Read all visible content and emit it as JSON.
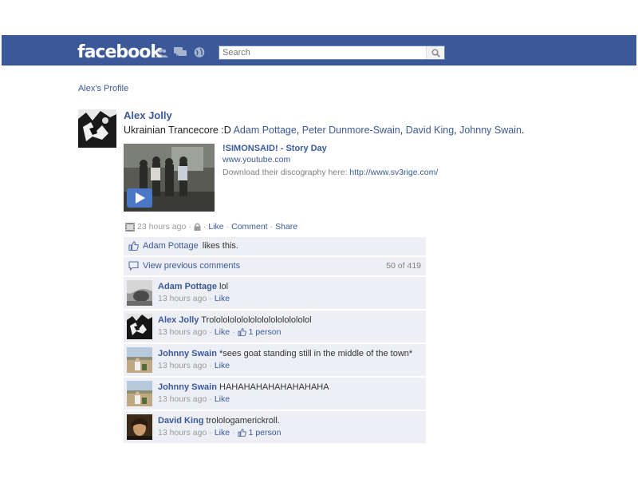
{
  "header": {
    "logo": "facebook",
    "icons": [
      "friend-requests-icon",
      "messages-icon",
      "notifications-icon"
    ],
    "search_placeholder": "Search",
    "bar_color": "#3b5998"
  },
  "breadcrumb": "Alex's Profile",
  "post": {
    "author": "Alex Jolly",
    "message_prefix": "Ukrainian Trancecore :D",
    "tags": [
      "Adam Pottage",
      "Peter Dunmore-Swain",
      "David King",
      "Johnny Swain"
    ],
    "message_suffix": ".",
    "attachment": {
      "title": "!SIMONSAID! - Story Day",
      "domain": "www.youtube.com",
      "description": "Download their discography here:",
      "description_link": "http://www.sv3rige.com/"
    },
    "time": "23 hours ago",
    "like": "Like",
    "comment": "Comment",
    "share": "Share"
  },
  "likes": {
    "person": "Adam Pottage",
    "text": "likes this."
  },
  "previous": {
    "label": "View previous comments",
    "count": "50 of 419"
  },
  "comments": [
    {
      "author": "Adam Pottage",
      "text": "lol",
      "time": "13 hours ago",
      "like": "Like",
      "likes": ""
    },
    {
      "author": "Alex Jolly",
      "text": "Trololololololololololololololol",
      "time": "13 hours ago",
      "like": "Like",
      "likes": "1 person"
    },
    {
      "author": "Johnny Swain",
      "text": "*sees goat standing still in the middle of the town*",
      "time": "13 hours ago",
      "like": "Like",
      "likes": ""
    },
    {
      "author": "Johnny Swain",
      "text": "HAHAHAHAHAHAHAHAHA",
      "time": "13 hours ago",
      "like": "Like",
      "likes": ""
    },
    {
      "author": "David King",
      "text": "trolologamerickroll.",
      "time": "13 hours ago",
      "like": "Like",
      "likes": "1 person"
    }
  ]
}
